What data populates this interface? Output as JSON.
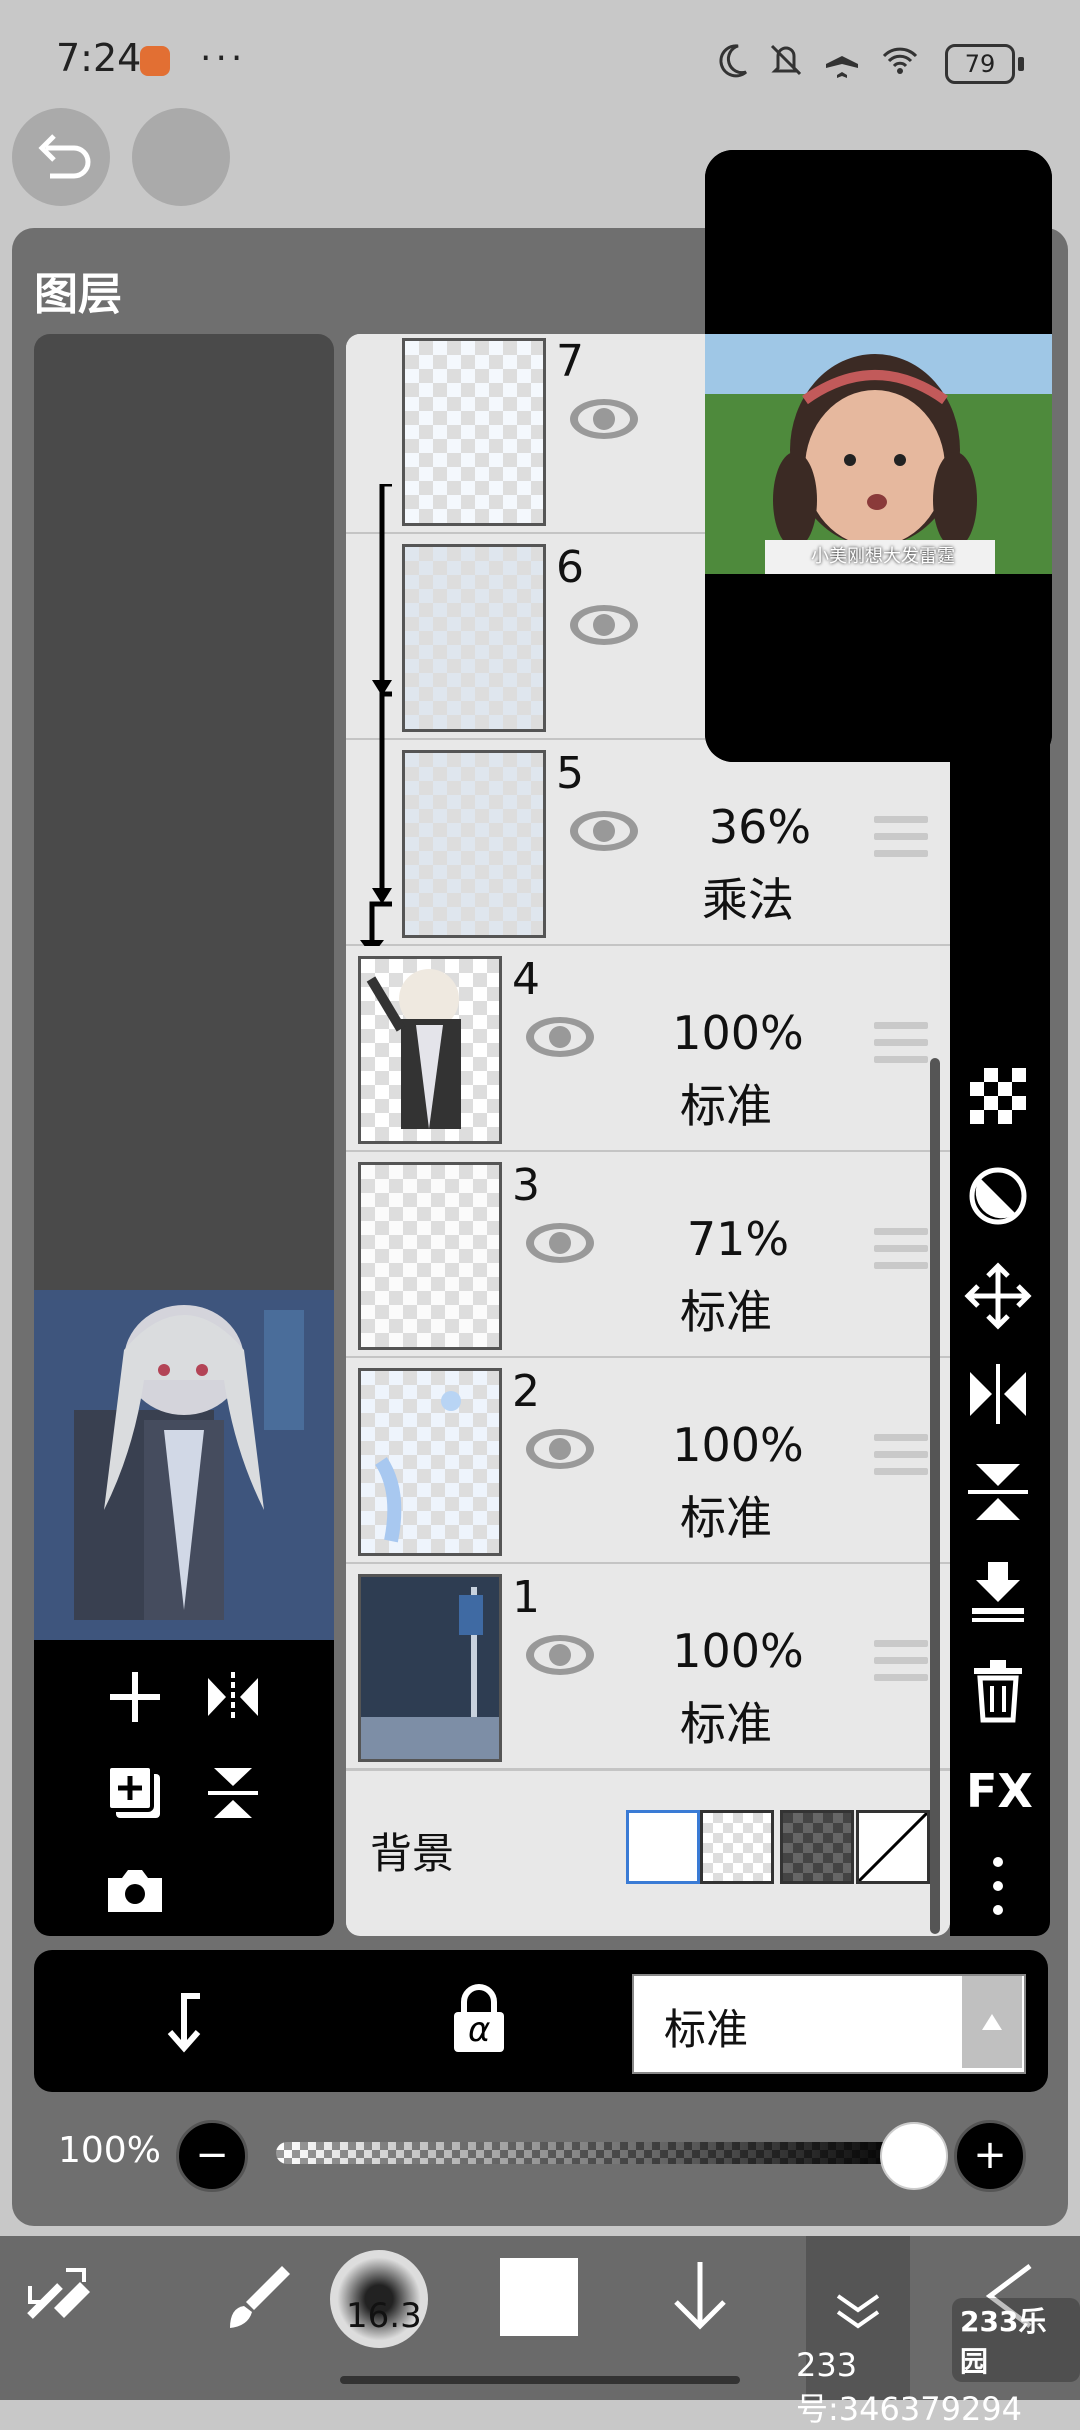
{
  "status": {
    "time": "7:24",
    "more": "···",
    "battery": "79"
  },
  "dialog": {
    "title": "图层"
  },
  "layers": [
    {
      "num": "7",
      "opacity": "",
      "blend": ""
    },
    {
      "num": "6",
      "opacity": "",
      "blend": ""
    },
    {
      "num": "5",
      "opacity": "36%",
      "blend": "乘法"
    },
    {
      "num": "4",
      "opacity": "100%",
      "blend": "标准"
    },
    {
      "num": "3",
      "opacity": "71%",
      "blend": "标准"
    },
    {
      "num": "2",
      "opacity": "100%",
      "blend": "标准"
    },
    {
      "num": "1",
      "opacity": "100%",
      "blend": "标准"
    }
  ],
  "background": {
    "label": "背景"
  },
  "right_tools": {
    "fx": "FX"
  },
  "bottom": {
    "blend_mode": "标准",
    "opacity_label": "100%",
    "opacity_value": 1.0,
    "alpha_symbol": "α"
  },
  "toolbar": {
    "brush_size": "16.3"
  },
  "video": {
    "caption": "小美刚想大发雷霆"
  },
  "watermark": {
    "logo": "233乐园",
    "text": "233号:346379294"
  },
  "colors": {
    "dialog": "#6f6f6f",
    "list_bg": "#e8e8e8",
    "toolbar": "#000000",
    "accent_blue": "#3a7bd5"
  }
}
